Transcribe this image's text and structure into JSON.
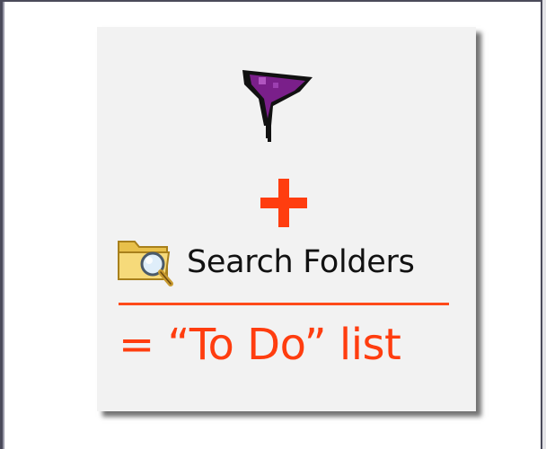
{
  "diagram": {
    "icons": {
      "flag": "purple-flag-icon",
      "operator": "plus-icon",
      "folder": "search-folder-icon"
    },
    "search_folders_label": "Search Folders",
    "result_label": "= “To Do” list",
    "colors": {
      "accent": "#ff3d0f",
      "flag": "#7a1f8a",
      "card_background": "#f2f2f2"
    }
  }
}
